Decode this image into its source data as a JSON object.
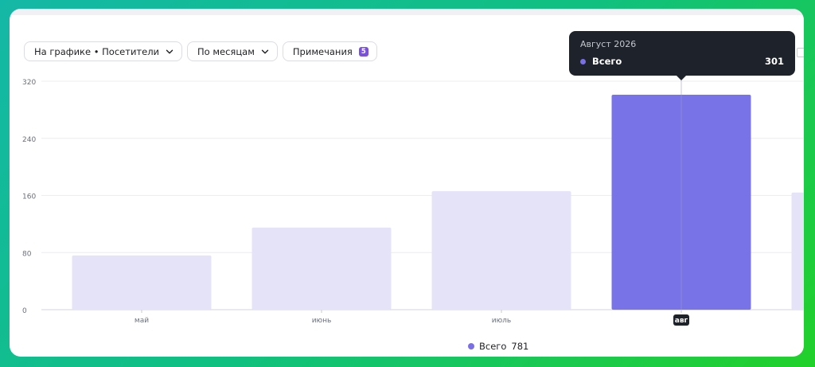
{
  "controls": {
    "metric_label": "На графике • Посетители",
    "period_label": "По месяцам",
    "notes_label": "Примечания",
    "notes_count": "5"
  },
  "tooltip": {
    "title": "Август 2026",
    "series_name": "Всего",
    "value": "301"
  },
  "legend": {
    "name": "Всего",
    "total": "781"
  },
  "colors": {
    "active_bar": "#7874e8",
    "inactive_bar": "#e5e3f8",
    "accent_badge": "#7b4fe0"
  },
  "chart_data": {
    "type": "bar",
    "categories": [
      "май",
      "июнь",
      "июль",
      "авг"
    ],
    "series": [
      {
        "name": "Всего",
        "values": [
          76,
          115,
          166,
          301
        ]
      }
    ],
    "highlighted_category": "авг",
    "partial_next_value": 164,
    "ylim": [
      0,
      320
    ],
    "yticks": [
      0,
      80,
      160,
      240,
      320
    ],
    "grid": true,
    "legend_position": "bottom-center"
  }
}
